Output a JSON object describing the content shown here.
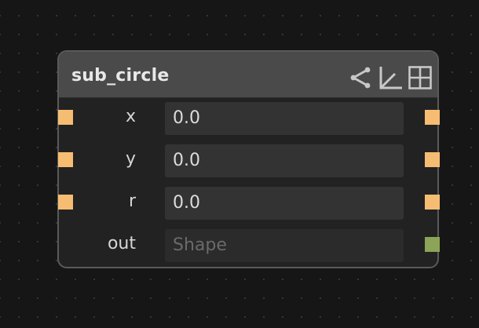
{
  "node": {
    "title": "sub_circle",
    "icons": [
      "share-icon",
      "axis-icon",
      "grid-icon"
    ],
    "rows": [
      {
        "label": "x",
        "value": "0.0",
        "placeholder": "",
        "port_color": "#f6bd72",
        "in_port_color": "#f6bd72"
      },
      {
        "label": "y",
        "value": "0.0",
        "placeholder": "",
        "port_color": "#f6bd72",
        "in_port_color": "#f6bd72"
      },
      {
        "label": "r",
        "value": "0.0",
        "placeholder": "",
        "port_color": "#f6bd72",
        "in_port_color": "#f6bd72"
      },
      {
        "label": "out",
        "value": "",
        "placeholder": "Shape",
        "port_color": "#8ba457",
        "in_port_color": ""
      }
    ]
  },
  "colors": {
    "number_port": "#f6bd72",
    "shape_port": "#8ba457",
    "header": "#4a4a4a",
    "body": "#222222",
    "border": "#5a5a5a",
    "background": "#161616"
  }
}
